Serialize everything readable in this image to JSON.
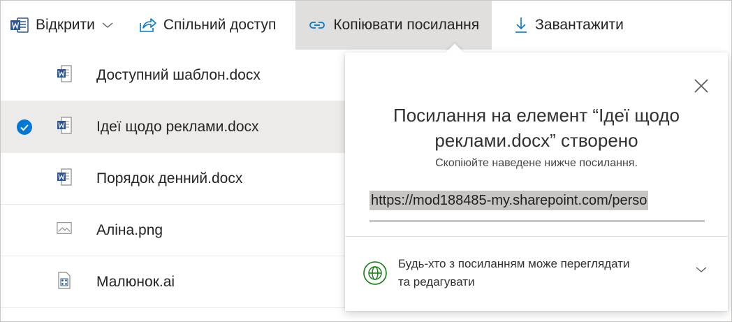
{
  "toolbar": {
    "open_label": "Відкрити",
    "share_label": "Спільний доступ",
    "copy_link_label": "Копіювати посилання",
    "download_label": "Завантажити"
  },
  "files": [
    {
      "name": "Доступний шаблон.docx",
      "icon": "word-doc-icon",
      "selected": false
    },
    {
      "name": "Ідеї щодо реклами.docx",
      "icon": "word-doc-icon",
      "selected": true
    },
    {
      "name": "Порядок денний.docx",
      "icon": "word-doc-icon",
      "selected": false
    },
    {
      "name": "Аліна.png",
      "icon": "image-file-icon",
      "selected": false
    },
    {
      "name": "Малюнок.ai",
      "icon": "illustrator-file-icon",
      "selected": false
    }
  ],
  "popover": {
    "title_line1": "Посилання на елемент “Ідеї щодо",
    "title_line2": "реклами.docx” створено",
    "subtitle": "Скопіюйте наведене нижче посилання.",
    "link_value": "https://mod188485-my.sharepoint.com/perso",
    "permission_line1": "Будь-хто з посиланням може переглядати",
    "permission_line2": "та редагувати"
  },
  "colors": {
    "word_blue": "#2b579a",
    "check_blue": "#0078d4",
    "link_blue": "#0078d4",
    "globe_green": "#107c10",
    "active_toolbar_bg": "#e1dfdd",
    "selected_row_bg": "#edebe9"
  }
}
